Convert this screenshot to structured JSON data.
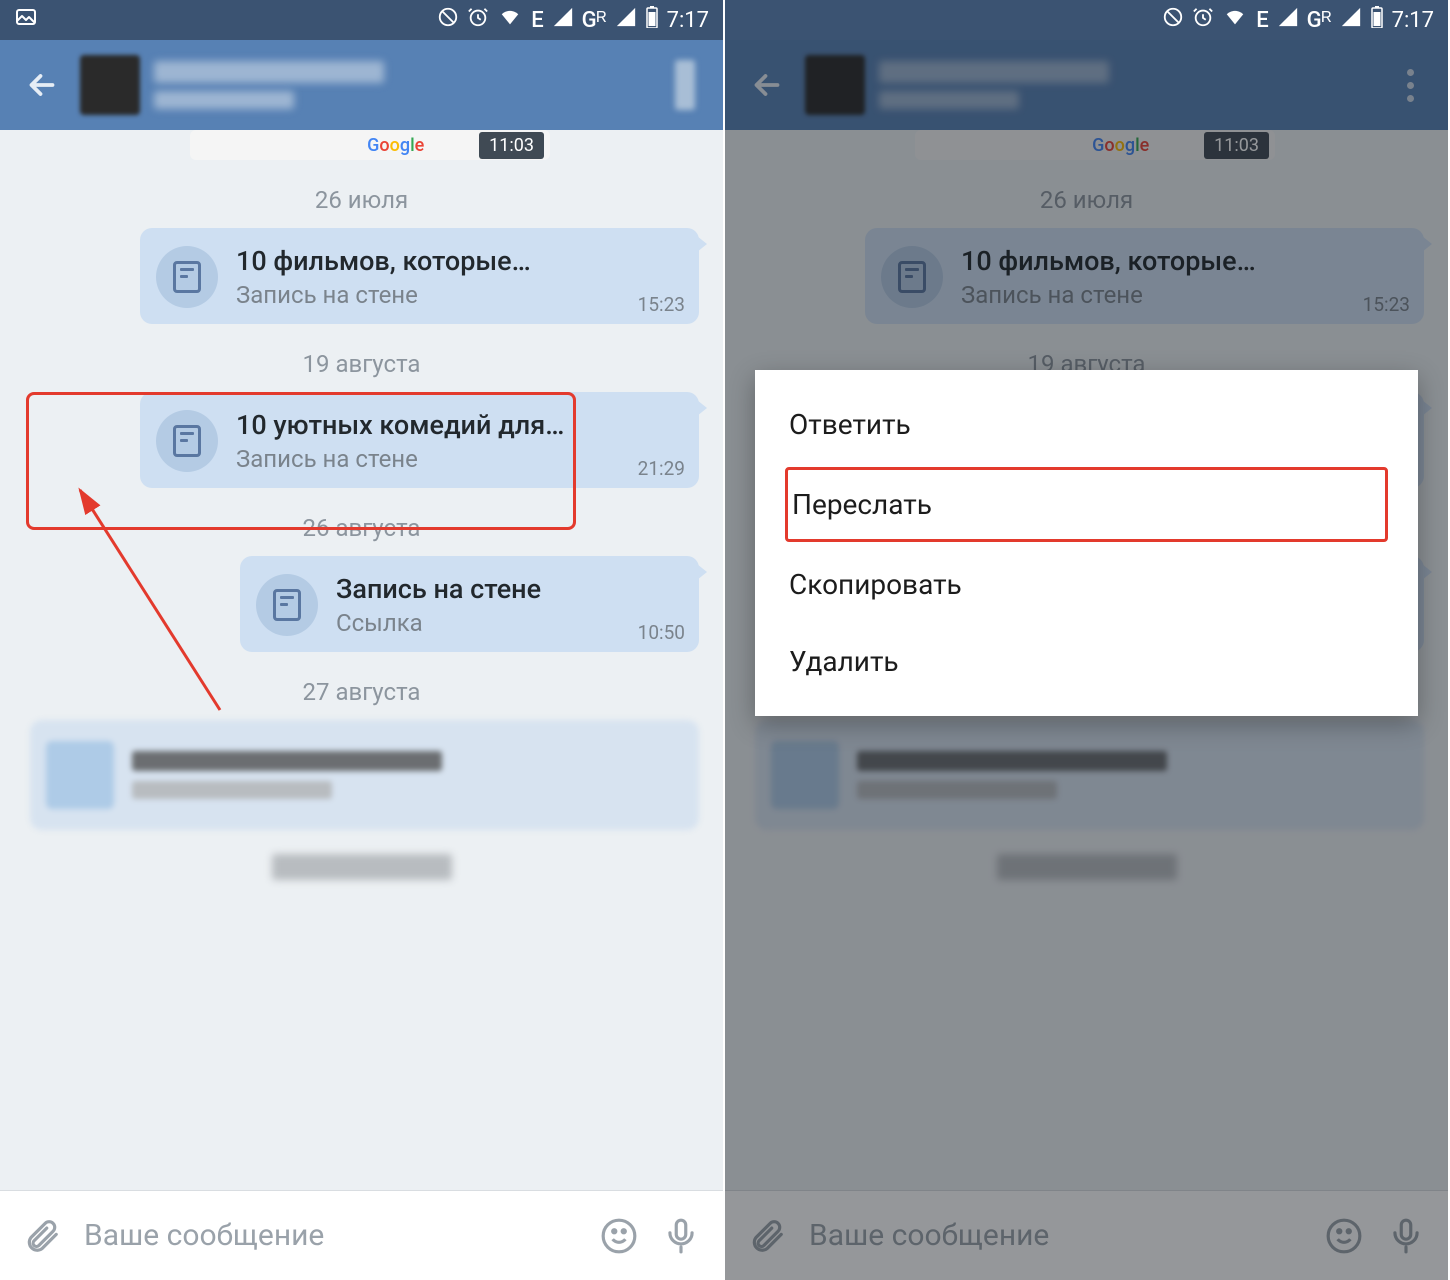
{
  "status": {
    "time": "7:17",
    "net": "E",
    "gr": "Gᴿ"
  },
  "map": {
    "time_chip": "11:03",
    "google": [
      "G",
      "o",
      "o",
      "g",
      "l",
      "e"
    ]
  },
  "dates": {
    "d1": "26 июля",
    "d2": "19 августа",
    "d3": "26 августа",
    "d4": "27 августа"
  },
  "msg1": {
    "title": "10 фильмов, которые…",
    "sub": "Запись на стене",
    "time": "15:23"
  },
  "msg2": {
    "title": "10 уютных комедий для…",
    "sub": "Запись на стене",
    "time": "21:29"
  },
  "msg3": {
    "title": "Запись на стене",
    "sub": "Ссылка",
    "time": "10:50"
  },
  "input": {
    "placeholder": "Ваше сообщение"
  },
  "menu": {
    "reply": "Ответить",
    "forward": "Переслать",
    "copy": "Скопировать",
    "delete": "Удалить"
  }
}
